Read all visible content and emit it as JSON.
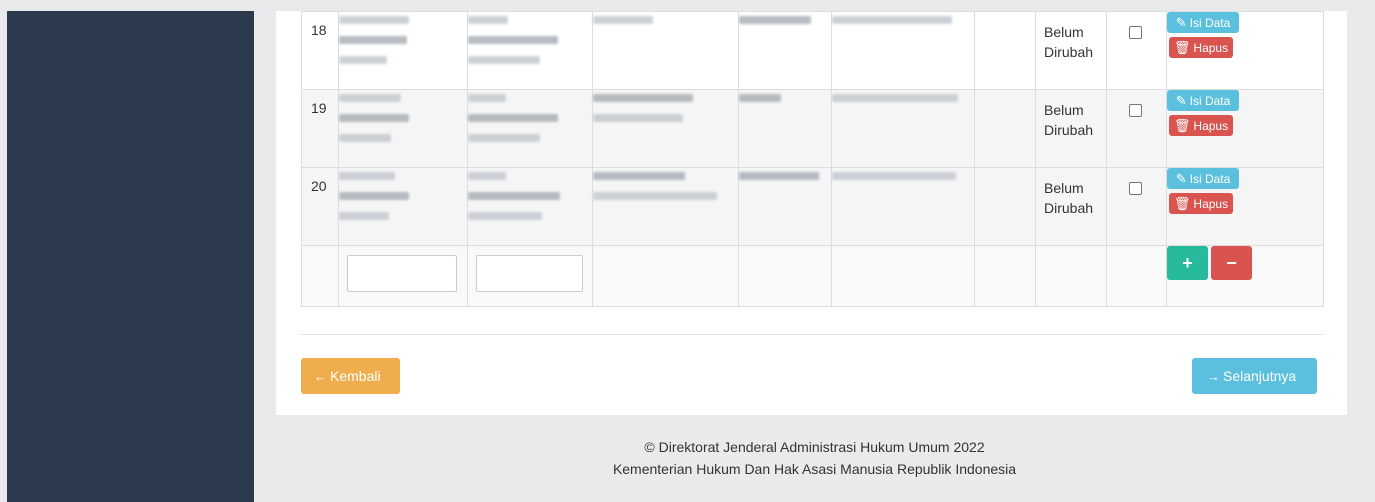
{
  "table": {
    "rows": [
      {
        "no": "18",
        "status": "Belum Dirubah",
        "edit_label": "Isi Data",
        "delete_label": "Hapus"
      },
      {
        "no": "19",
        "status": "Belum Dirubah",
        "edit_label": "Isi Data",
        "delete_label": "Hapus"
      },
      {
        "no": "20",
        "status": "Belum Dirubah",
        "edit_label": "Isi Data",
        "delete_label": "Hapus"
      }
    ],
    "new_row": {
      "add_symbol": "+",
      "remove_symbol": "−"
    }
  },
  "nav": {
    "back_label": "Kembali",
    "next_label": "Selanjutnya"
  },
  "footer": {
    "line1": "© Direktorat Jenderal Administrasi Hukum Umum 2022",
    "line2": "Kementerian Hukum Dan Hak Asasi Manusia Republik Indonesia"
  },
  "icons": {
    "edit": "pencil-icon",
    "delete": "trash-icon",
    "back": "arrow-left-icon",
    "next": "arrow-right-icon"
  },
  "colors": {
    "sidebar": "#2b3a4d",
    "info": "#5bc0de",
    "danger": "#d9534f",
    "success": "#26b99a",
    "warning": "#f0ad4e"
  }
}
